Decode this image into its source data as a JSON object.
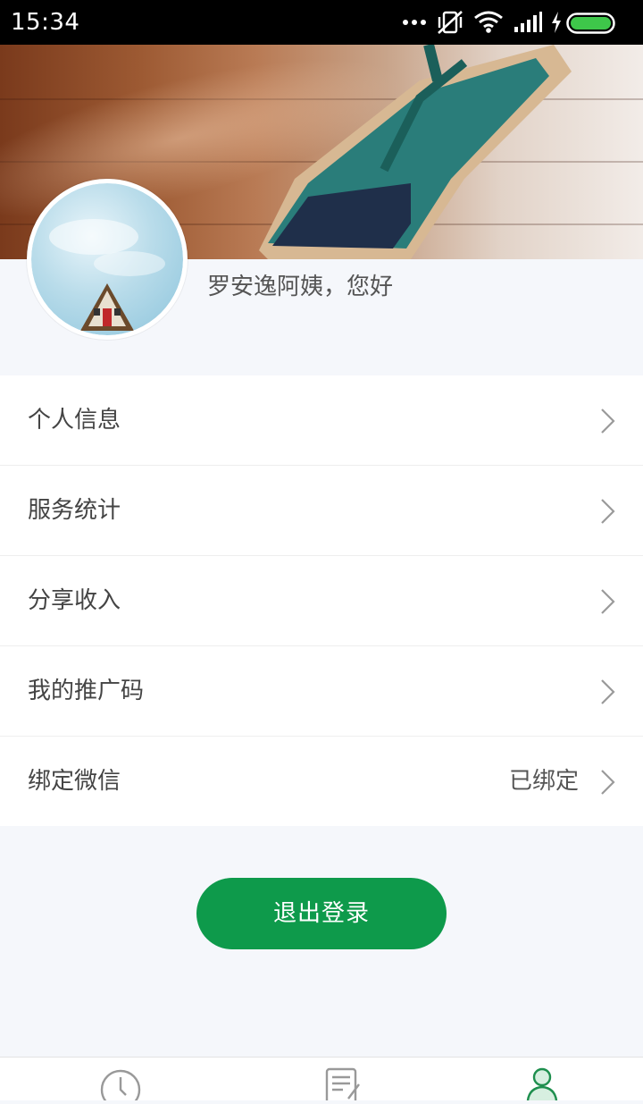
{
  "status_bar": {
    "time": "15:34",
    "icons": [
      "more-dots-icon",
      "vibrate-off-icon",
      "wifi-icon",
      "signal-icon",
      "charging-icon",
      "battery-icon"
    ]
  },
  "profile": {
    "greeting": "罗安逸阿姨，您好"
  },
  "menu": {
    "items": [
      {
        "label": "个人信息",
        "value": ""
      },
      {
        "label": "服务统计",
        "value": ""
      },
      {
        "label": "分享收入",
        "value": ""
      },
      {
        "label": "我的推广码",
        "value": ""
      },
      {
        "label": "绑定微信",
        "value": "已绑定"
      }
    ]
  },
  "logout": {
    "label": "退出登录"
  },
  "tabs": [
    {
      "icon": "clock-icon",
      "active": false
    },
    {
      "icon": "document-edit-icon",
      "active": false
    },
    {
      "icon": "user-icon",
      "active": true
    }
  ],
  "colors": {
    "accent": "#0e9a4b",
    "background": "#f5f7fb",
    "text": "#444444"
  }
}
